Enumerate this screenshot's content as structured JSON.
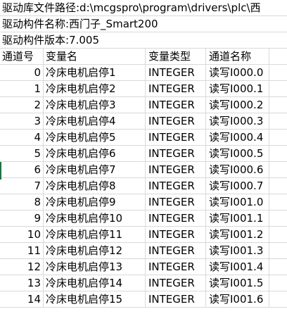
{
  "info": {
    "library_path": "驱动库文件路径:d:\\mcgspro\\program\\drivers\\plc\\西",
    "component_name": "驱动构件名称:西门子_Smart200",
    "component_version": "驱动构件版本:7.005"
  },
  "table": {
    "headers": [
      "通道号",
      "变量名",
      "变量类型",
      "通道名称"
    ],
    "rows": [
      [
        "0",
        "冷床电机启停1",
        "INTEGER",
        "读写I000.0"
      ],
      [
        "1",
        "冷床电机启停2",
        "INTEGER",
        "读写I000.1"
      ],
      [
        "2",
        "冷床电机启停3",
        "INTEGER",
        "读写I000.2"
      ],
      [
        "3",
        "冷床电机启停4",
        "INTEGER",
        "读写I000.3"
      ],
      [
        "4",
        "冷床电机启停5",
        "INTEGER",
        "读写I000.4"
      ],
      [
        "5",
        "冷床电机启停6",
        "INTEGER",
        "读写I000.5"
      ],
      [
        "6",
        "冷床电机启停7",
        "INTEGER",
        "读写I000.6"
      ],
      [
        "7",
        "冷床电机启停8",
        "INTEGER",
        "读写I000.7"
      ],
      [
        "8",
        "冷床电机启停9",
        "INTEGER",
        "读写I001.0"
      ],
      [
        "9",
        "冷床电机启停10",
        "INTEGER",
        "读写I001.1"
      ],
      [
        "10",
        "冷床电机启停11",
        "INTEGER",
        "读写I001.2"
      ],
      [
        "11",
        "冷床电机启停12",
        "INTEGER",
        "读写I001.3"
      ],
      [
        "12",
        "冷床电机启停13",
        "INTEGER",
        "读写I001.4"
      ],
      [
        "13",
        "冷床电机启停14",
        "INTEGER",
        "读写I001.5"
      ],
      [
        "14",
        "冷床电机启停15",
        "INTEGER",
        "读写I001.6"
      ]
    ]
  },
  "colors": {
    "gridline": "#d9d9d9",
    "selection_accent": "#1e7145"
  }
}
